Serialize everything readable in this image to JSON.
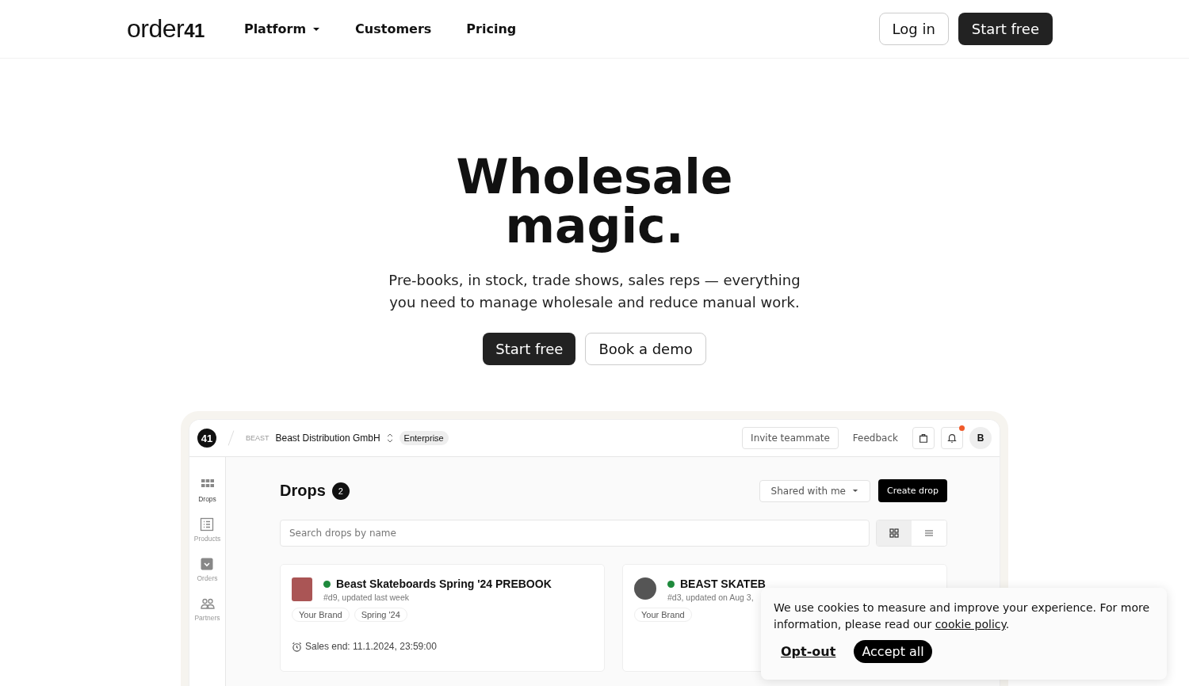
{
  "nav": {
    "logo": {
      "word": "order",
      "number": "41"
    },
    "links": [
      {
        "label": "Platform",
        "dropdown": true
      },
      {
        "label": "Customers",
        "dropdown": false
      },
      {
        "label": "Pricing",
        "dropdown": false
      }
    ],
    "login": "Log in",
    "start": "Start free"
  },
  "hero": {
    "title_lines": [
      "Wholesale",
      "magic."
    ],
    "subtitle_lines": [
      "Pre-books, in stock, trade shows, sales reps — everything",
      "you need to manage wholesale and reduce manual work."
    ],
    "primary": "Start free",
    "secondary": "Book a demo"
  },
  "app": {
    "badge": "41",
    "brand_logo": "BEAST",
    "company": "Beast Distribution GmbH",
    "plan": "Enterprise",
    "invite": "Invite teammate",
    "feedback": "Feedback",
    "notification_dot": true,
    "avatar": "B",
    "sidebar": [
      {
        "label": "Drops",
        "selected": true
      },
      {
        "label": "Products",
        "selected": false
      },
      {
        "label": "Orders",
        "selected": false
      },
      {
        "label": "Partners",
        "selected": false
      }
    ],
    "title": "Drops",
    "count": "2",
    "filter": "Shared with me",
    "create": "Create drop",
    "search": {
      "placeholder": "Search drops by name"
    },
    "views": [
      {
        "selected": true
      },
      {
        "selected": false
      }
    ],
    "drops": [
      {
        "title": "Beast Skateboards Spring '24 PREBOOK",
        "meta": "#d9, updated last week",
        "color": "#1e8a3c",
        "tags": [
          "Your Brand",
          "Spring '24"
        ],
        "sales_end": "Sales end: 11.1.2024, 23:59:00"
      },
      {
        "title": "BEAST SKATEB",
        "meta": "#d3, updated on Aug 3,",
        "color": "#1e8a3c",
        "tags": [
          "Your Brand"
        ]
      }
    ]
  },
  "cookie": {
    "text_before": "We use cookies to measure and improve your experience. For more information, please read our",
    "link": "cookie policy",
    "text_after": ".",
    "optout": "Opt-out",
    "accept": "Accept all"
  }
}
